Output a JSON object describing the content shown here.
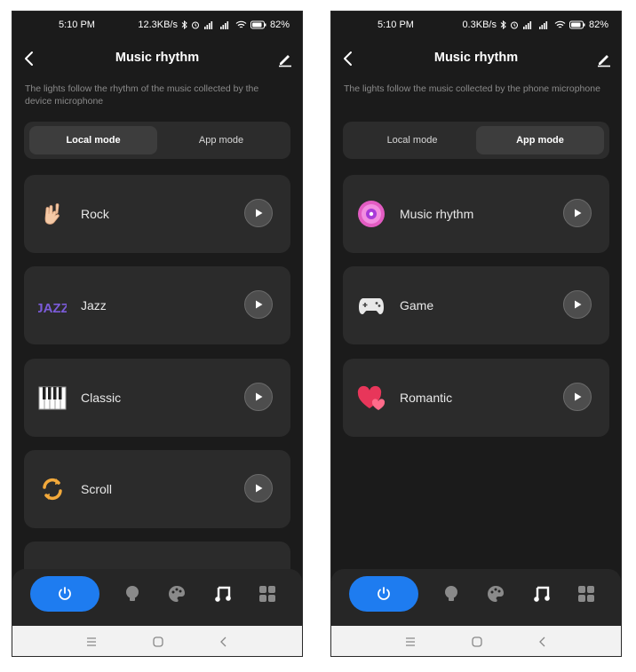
{
  "left": {
    "status": {
      "time": "5:10 PM",
      "speed": "12.3KB/s",
      "battery": "82"
    },
    "header": {
      "title": "Music rhythm"
    },
    "description": "The lights follow the rhythm of the music collected by the device microphone",
    "modes": {
      "local": "Local mode",
      "app": "App mode",
      "active": "local"
    },
    "items": [
      {
        "label": "Rock",
        "icon": "rock-hand-icon"
      },
      {
        "label": "Jazz",
        "icon": "jazz-logo-icon",
        "icon_text": "JAZZ"
      },
      {
        "label": "Classic",
        "icon": "piano-icon"
      },
      {
        "label": "Scroll",
        "icon": "scroll-arrows-icon"
      }
    ]
  },
  "right": {
    "status": {
      "time": "5:10 PM",
      "speed": "0.3KB/s",
      "battery": "82"
    },
    "header": {
      "title": "Music rhythm"
    },
    "description": "The lights follow the music collected by the phone microphone",
    "modes": {
      "local": "Local mode",
      "app": "App mode",
      "active": "app"
    },
    "items": [
      {
        "label": "Music rhythm",
        "icon": "vinyl-disc-icon"
      },
      {
        "label": "Game",
        "icon": "gamepad-icon"
      },
      {
        "label": "Romantic",
        "icon": "hearts-icon"
      }
    ]
  },
  "colors": {
    "accent": "#1e7cf0",
    "background": "#1b1b1b",
    "card": "#2b2b2b"
  }
}
